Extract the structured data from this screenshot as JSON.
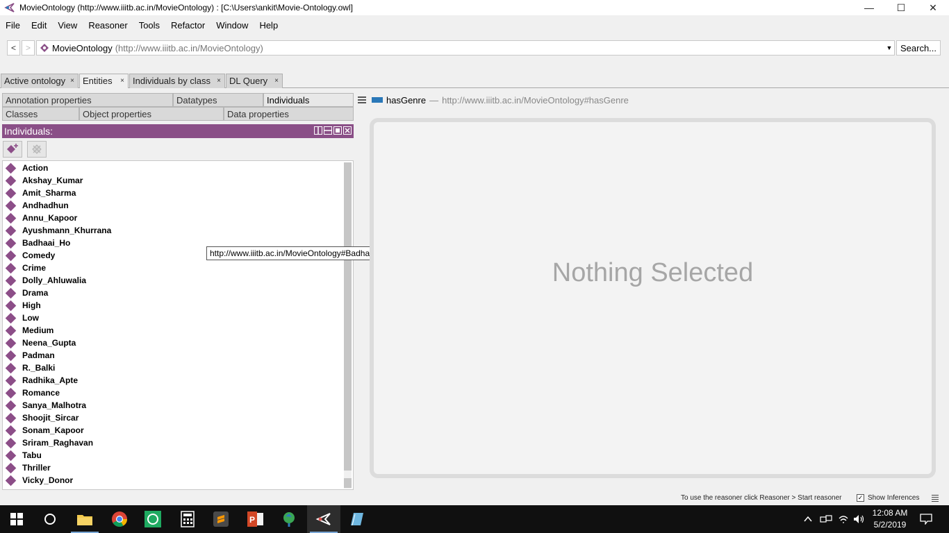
{
  "window": {
    "title": "MovieOntology (http://www.iiitb.ac.in/MovieOntology)  : [C:\\Users\\ankit\\Movie-Ontology.owl]",
    "minimize": "—",
    "maximize": "☐",
    "close": "✕"
  },
  "menu": [
    "File",
    "Edit",
    "View",
    "Reasoner",
    "Tools",
    "Refactor",
    "Window",
    "Help"
  ],
  "address": {
    "back": "<",
    "forward": ">",
    "ontology_name": "MovieOntology",
    "ontology_iri": "(http://www.iiitb.ac.in/MovieOntology)",
    "search_label": "Search..."
  },
  "tabs": [
    {
      "label": "Active ontology",
      "active": false
    },
    {
      "label": "Entities",
      "active": true
    },
    {
      "label": "Individuals by class",
      "active": false
    },
    {
      "label": "DL Query",
      "active": false
    }
  ],
  "tab_close": "×",
  "entity_tabs": {
    "row1": [
      "Annotation properties",
      "Datatypes",
      "Individuals"
    ],
    "row2": [
      "Classes",
      "Object properties",
      "Data properties"
    ],
    "active": "Individuals"
  },
  "individuals_panel": {
    "title": "Individuals:",
    "items": [
      "Action",
      "Akshay_Kumar",
      "Amit_Sharma",
      "Andhadhun",
      "Annu_Kapoor",
      "Ayushmann_Khurrana",
      "Badhaai_Ho",
      "Comedy",
      "Crime",
      "Dolly_Ahluwalia",
      "Drama",
      "High",
      "Low",
      "Medium",
      "Neena_Gupta",
      "Padman",
      "R._Balki",
      "Radhika_Apte",
      "Romance",
      "Sanya_Malhotra",
      "Shoojit_Sircar",
      "Sonam_Kapoor",
      "Sriram_Raghavan",
      "Tabu",
      "Thriller",
      "Vicky_Donor"
    ]
  },
  "tooltip": "http://www.iiitb.ac.in/MovieOntology#Badhaai_Ho",
  "selected_entity": {
    "name": "hasGenre",
    "separator": "—",
    "iri": "http://www.iiitb.ac.in/MovieOntology#hasGenre"
  },
  "main_panel": {
    "message": "Nothing Selected"
  },
  "status": {
    "hint": "To use the reasoner click Reasoner > Start reasoner",
    "show_inferences_label": "Show Inferences",
    "show_inferences_checked": "✓"
  },
  "taskbar": {
    "time": "12:08 AM",
    "date": "5/2/2019"
  },
  "colors": {
    "panel_header": "#8a4f87",
    "individual_icon": "#8c4e88",
    "object_property": "#2a78b8"
  }
}
